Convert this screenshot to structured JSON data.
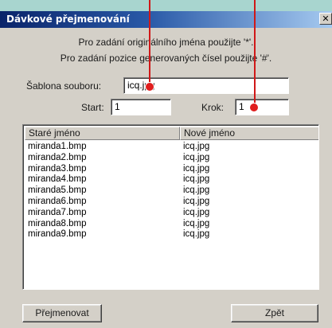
{
  "window": {
    "title": "Dávkové přejmenování",
    "close_glyph": "✕"
  },
  "info": {
    "line1": "Pro zadání originálního jména použijte '*'.",
    "line2": "Pro zadání pozice generovaných čísel použijte '#'."
  },
  "form": {
    "template_label": "Šablona souboru:",
    "template_value": "icq.jpg",
    "start_label": "Start:",
    "start_value": "1",
    "step_label": "Krok:",
    "step_value": "1"
  },
  "list": {
    "columns": [
      "Staré jméno",
      "Nové jméno"
    ],
    "rows": [
      [
        "miranda1.bmp",
        "icq.jpg"
      ],
      [
        "miranda2.bmp",
        "icq.jpg"
      ],
      [
        "miranda3.bmp",
        "icq.jpg"
      ],
      [
        "miranda4.bmp",
        "icq.jpg"
      ],
      [
        "miranda5.bmp",
        "icq.jpg"
      ],
      [
        "miranda6.bmp",
        "icq.jpg"
      ],
      [
        "miranda7.bmp",
        "icq.jpg"
      ],
      [
        "miranda8.bmp",
        "icq.jpg"
      ],
      [
        "miranda9.bmp",
        "icq.jpg"
      ]
    ]
  },
  "buttons": {
    "rename": "Přejmenovat",
    "back": "Zpět"
  },
  "colors": {
    "accent": "#e01e1e",
    "title_bar": "#0a246a",
    "background": "#a8d5cf"
  }
}
